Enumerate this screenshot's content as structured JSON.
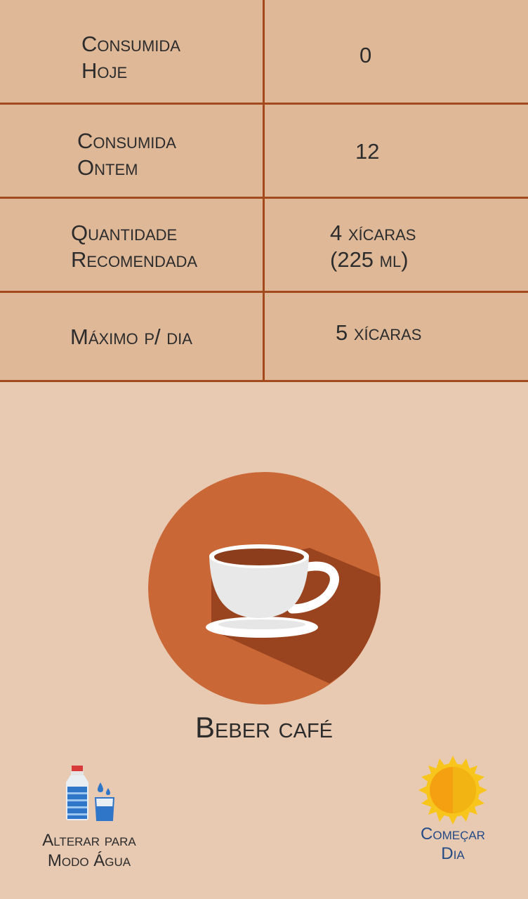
{
  "stats": {
    "rows": [
      {
        "label_line1": "Consumida",
        "label_line2": "Hoje",
        "value_line1": "0",
        "value_line2": ""
      },
      {
        "label_line1": "Consumida",
        "label_line2": "Ontem",
        "value_line1": "12",
        "value_line2": ""
      },
      {
        "label_line1": "Quantidade",
        "label_line2": "Recomendada",
        "value_line1": "4 xícaras",
        "value_line2": "(225 ml)"
      },
      {
        "label_line1": "Máximo p/ dia",
        "label_line2": "",
        "value_line1": "5 xícaras",
        "value_line2": ""
      }
    ]
  },
  "main_action": {
    "label": "Beber café",
    "icon": "coffee-cup-icon"
  },
  "water_mode": {
    "label_line1": "Alterar para",
    "label_line2": "Modo Água",
    "icon": "water-bottle-glass-icon"
  },
  "start_day": {
    "label_line1": "Começar",
    "label_line2": "Dia",
    "icon": "sun-icon"
  },
  "colors": {
    "background": "#e8c9b1",
    "table_background": "#dfb898",
    "table_border": "#a2491e",
    "button_circle": "#c96737",
    "button_shadow": "#99441f",
    "accent_blue": "#234a86"
  }
}
